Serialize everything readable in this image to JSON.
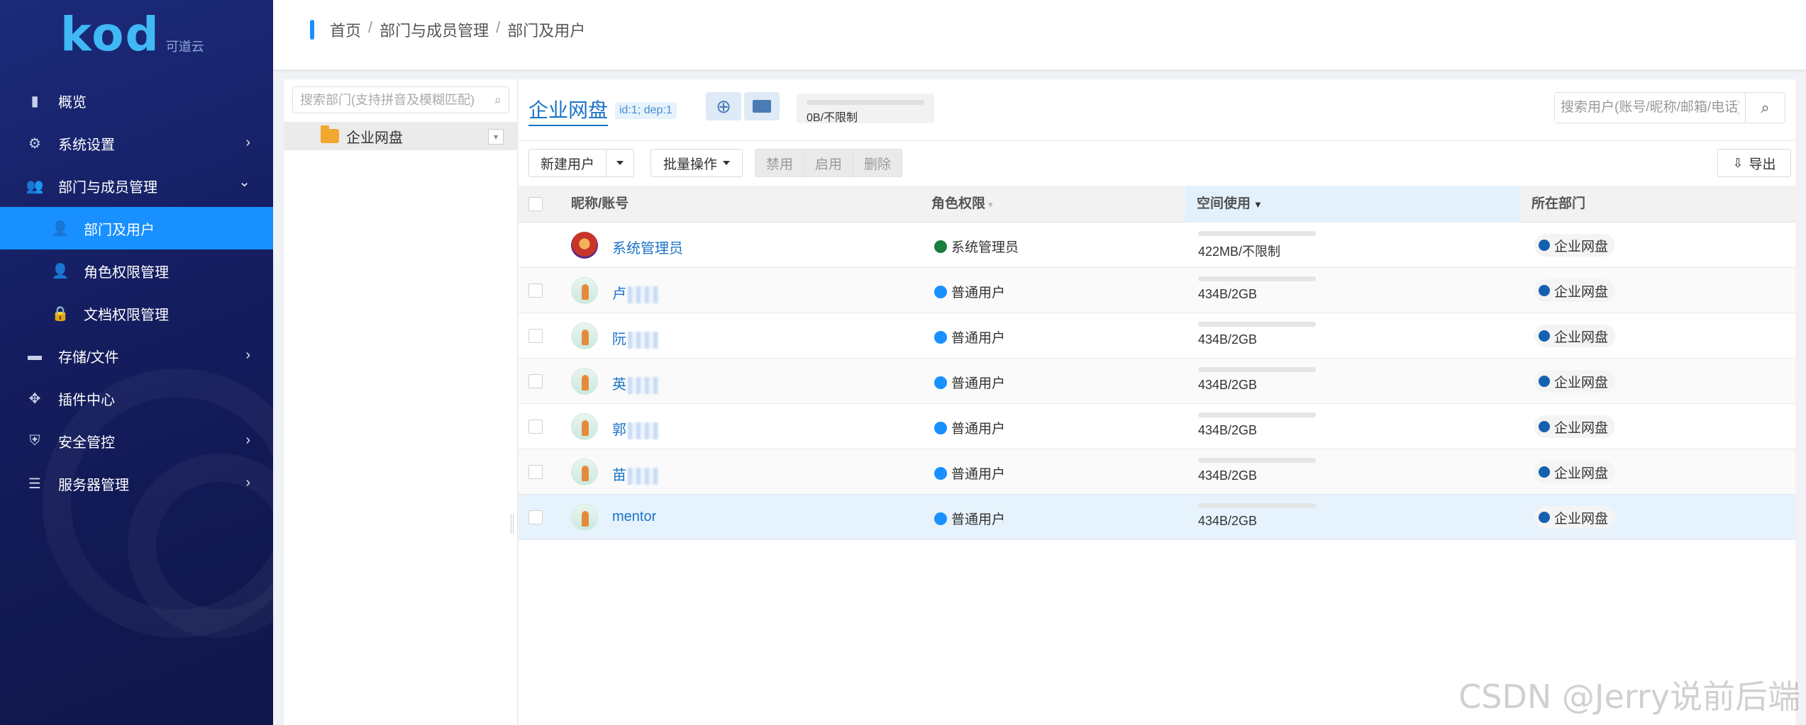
{
  "app": {
    "logo_text": "kod",
    "logo_sub": "可道云"
  },
  "sidebar": {
    "items": [
      {
        "label": "概览",
        "icon": "bar-chart-icon",
        "arrow": ""
      },
      {
        "label": "系统设置",
        "icon": "gear-icon",
        "arrow": "›"
      },
      {
        "label": "部门与成员管理",
        "icon": "users-icon",
        "arrow": "⌄"
      },
      {
        "label": "部门及用户",
        "icon": "user-icon",
        "arrow": ""
      },
      {
        "label": "角色权限管理",
        "icon": "user-role-icon",
        "arrow": ""
      },
      {
        "label": "文档权限管理",
        "icon": "lock-icon",
        "arrow": ""
      },
      {
        "label": "存储/文件",
        "icon": "folder-icon",
        "arrow": "›"
      },
      {
        "label": "插件中心",
        "icon": "plugin-icon",
        "arrow": ""
      },
      {
        "label": "安全管控",
        "icon": "shield-icon",
        "arrow": "›"
      },
      {
        "label": "服务器管理",
        "icon": "server-icon",
        "arrow": "›"
      }
    ],
    "active_color": "#1890ff"
  },
  "breadcrumb": [
    "首页",
    "部门与成员管理",
    "部门及用户"
  ],
  "tree": {
    "search_placeholder": "搜索部门(支持拼音及模糊匹配)",
    "root_label": "企业网盘"
  },
  "dept": {
    "title": "企业网盘",
    "id_label": "id:1; dep:1",
    "quota": "0B/不限制"
  },
  "toolbar": {
    "new_user": "新建用户",
    "batch": "批量操作",
    "disable": "禁用",
    "enable": "启用",
    "delete": "删除",
    "export": "导出",
    "search_placeholder": "搜索用户(账号/昵称/邮箱/电话)"
  },
  "table": {
    "headers": [
      "昵称/账号",
      "角色权限",
      "空间使用",
      "所在部门"
    ],
    "rows": [
      {
        "name": "系统管理员",
        "blurred": false,
        "role": "系统管理员",
        "role_color": "#1a7f3c",
        "space": "422MB/不限制",
        "dept": "企业网盘",
        "dept_color": "#1560b0"
      },
      {
        "name": "卢",
        "blurred": true,
        "role": "普通用户",
        "role_color": "#1890ff",
        "space": "434B/2GB",
        "dept": "企业网盘",
        "dept_color": "#1560b0"
      },
      {
        "name": "阮",
        "blurred": true,
        "role": "普通用户",
        "role_color": "#1890ff",
        "space": "434B/2GB",
        "dept": "企业网盘",
        "dept_color": "#1560b0"
      },
      {
        "name": "英",
        "blurred": true,
        "role": "普通用户",
        "role_color": "#1890ff",
        "space": "434B/2GB",
        "dept": "企业网盘",
        "dept_color": "#1560b0"
      },
      {
        "name": "郭",
        "blurred": true,
        "role": "普通用户",
        "role_color": "#1890ff",
        "space": "434B/2GB",
        "dept": "企业网盘",
        "dept_color": "#1560b0"
      },
      {
        "name": "苗",
        "blurred": true,
        "role": "普通用户",
        "role_color": "#1890ff",
        "space": "434B/2GB",
        "dept": "企业网盘",
        "dept_color": "#1560b0"
      },
      {
        "name": "mentor",
        "blurred": false,
        "role": "普通用户",
        "role_color": "#1890ff",
        "space": "434B/2GB",
        "dept": "企业网盘",
        "dept_color": "#1560b0"
      }
    ]
  },
  "watermark": "CSDN @Jerry说前后端"
}
